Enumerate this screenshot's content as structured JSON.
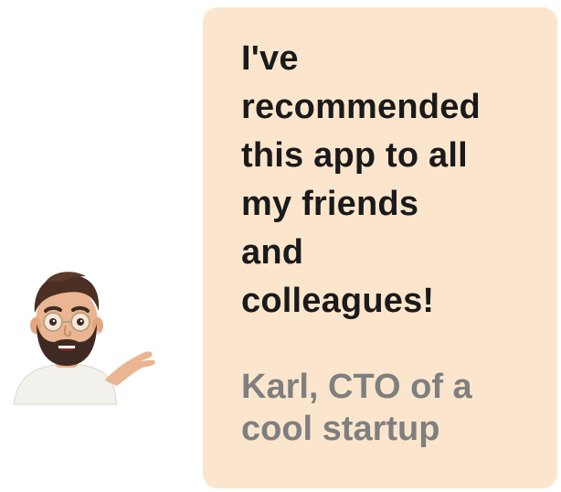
{
  "testimonial": {
    "quote": "I've\nrecommended\nthis app to all\nmy friends\nand\ncolleagues!",
    "attribution": "Karl, CTO of a\ncool startup"
  },
  "avatar": {
    "icon": "memoji-man-shrug-icon"
  },
  "colors": {
    "card_background": "#fbe6cd",
    "quote_text": "#1a1a1a",
    "attribution_text": "#7f7f7f"
  }
}
